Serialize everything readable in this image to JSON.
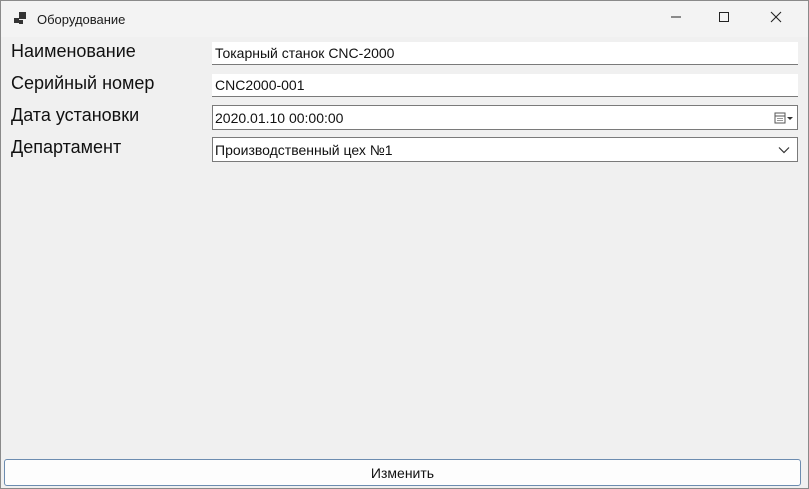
{
  "window": {
    "title": "Оборудование"
  },
  "form": {
    "name_label": "Наименование",
    "name_value": "Токарный станок CNC-2000",
    "serial_label": "Серийный номер",
    "serial_value": "CNC2000-001",
    "install_date_label": "Дата установки",
    "install_date_value": "2020.01.10 00:00:00",
    "department_label": "Департамент",
    "department_value": "Производственный цех №1"
  },
  "actions": {
    "apply_label": "Изменить"
  },
  "icons": {
    "app": "app-icon",
    "minimize": "minimize-icon",
    "maximize": "maximize-icon",
    "close": "close-icon",
    "calendar": "calendar-icon",
    "dropdown": "chevron-down-icon"
  },
  "colors": {
    "window_bg": "#f0f0f0",
    "button_border": "#6c8cb0"
  }
}
